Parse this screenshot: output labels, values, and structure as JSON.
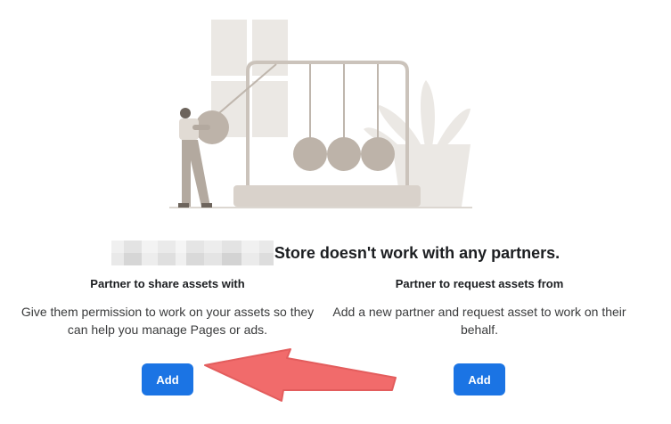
{
  "headline": {
    "text": "Store doesn't work with any partners."
  },
  "partner_share": {
    "title": "Partner to share assets with",
    "description": "Give them permission to work on your assets so they can help you manage Pages or ads.",
    "button_label": "Add"
  },
  "partner_request": {
    "title": "Partner to request assets from",
    "description": "Add a new partner and request asset to work on their behalf.",
    "button_label": "Add"
  },
  "colors": {
    "accent": "#1b74e4",
    "annotation_arrow": "#f16b6b",
    "illustration_gray": "#bfb6ad"
  },
  "icons": {
    "illustration": "newtons-cradle-illustration",
    "annotation": "pointer-arrow-icon"
  }
}
